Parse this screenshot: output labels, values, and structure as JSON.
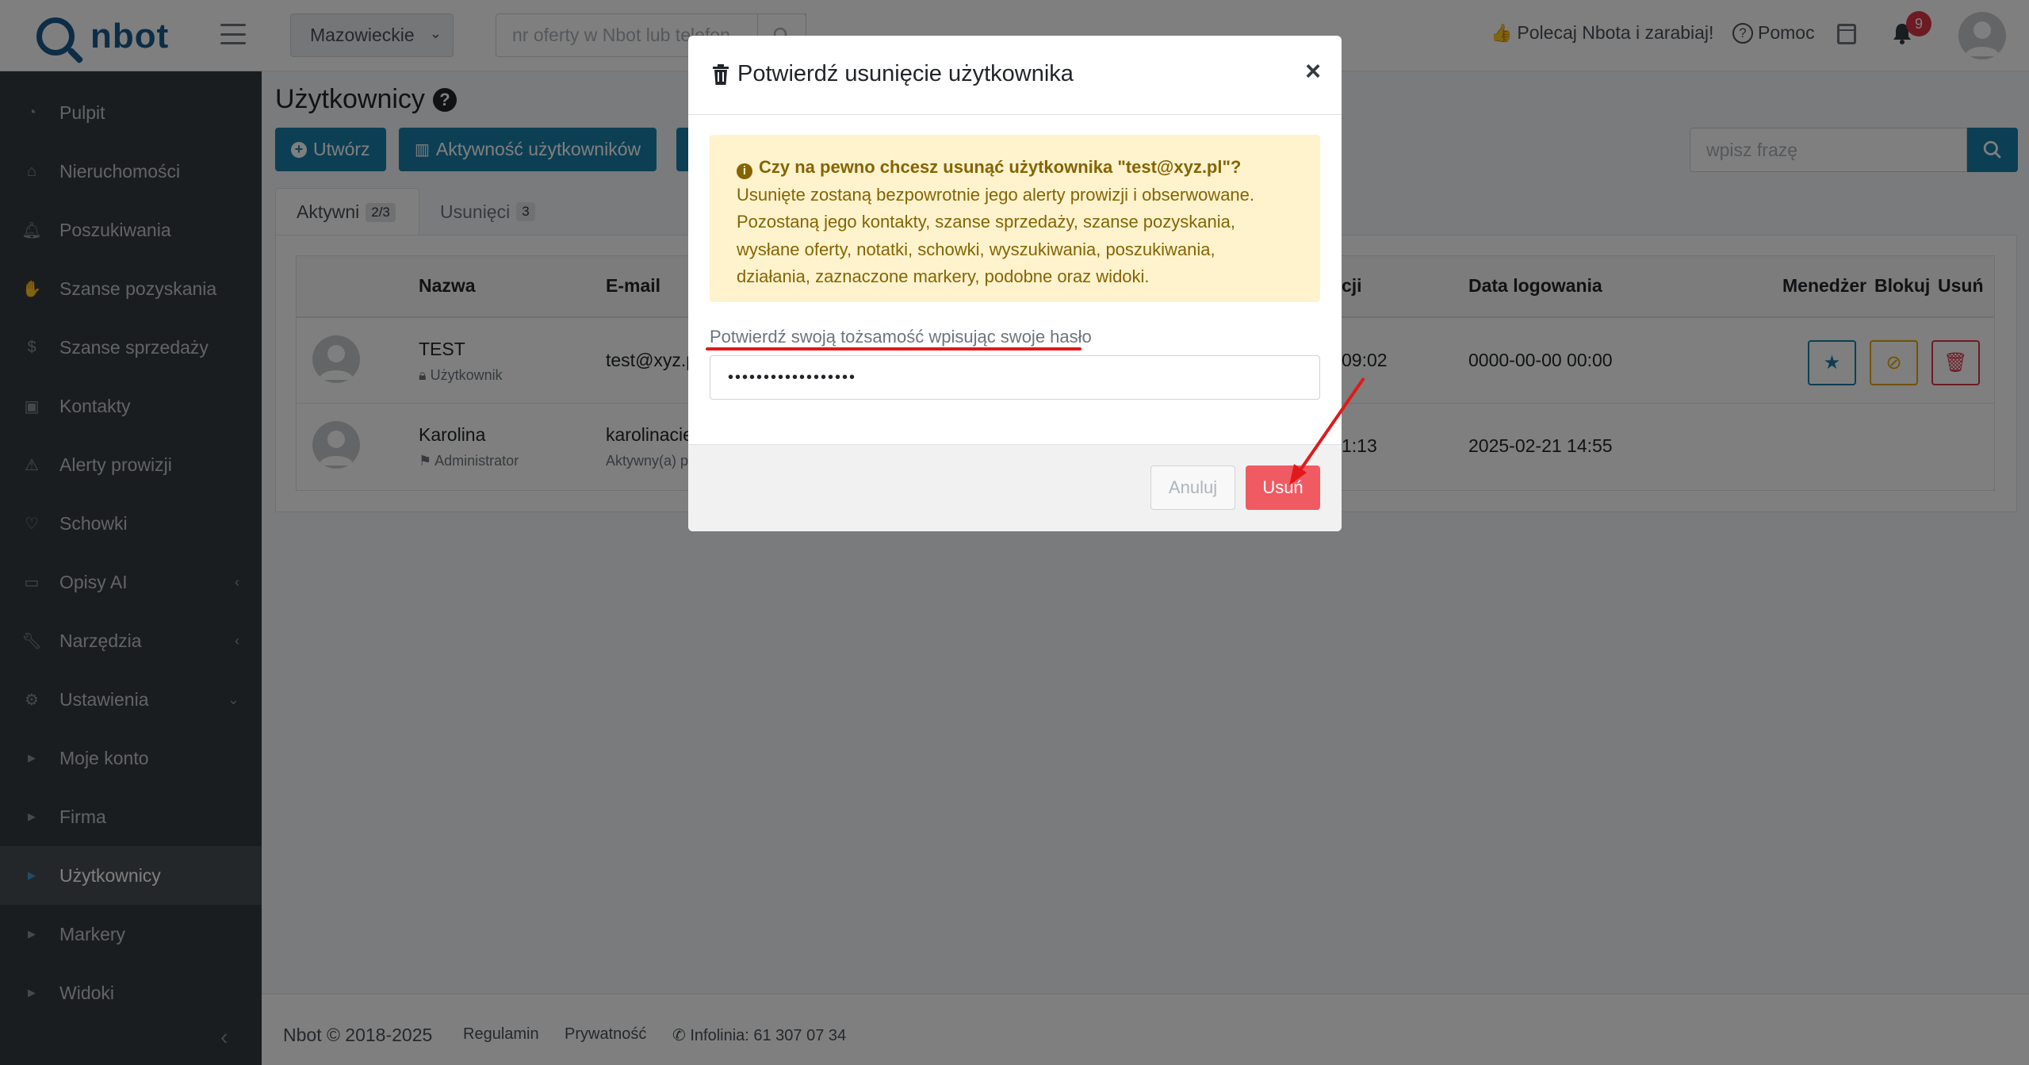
{
  "header": {
    "logo_text": "nbot",
    "region": "Mazowieckie",
    "offer_search_placeholder": "nr oferty w Nbot lub telefon",
    "recommend": "Polecaj Nbota i zarabiaj!",
    "help": "Pomoc",
    "notifications_count": "9"
  },
  "sidebar": {
    "items": [
      {
        "label": "Pulpit",
        "icon": "gauge-icon"
      },
      {
        "label": "Nieruchomości",
        "icon": "house-icon"
      },
      {
        "label": "Poszukiwania",
        "icon": "bell-icon"
      },
      {
        "label": "Szanse pozyskania",
        "icon": "handshake-icon"
      },
      {
        "label": "Szanse sprzedaży",
        "icon": "dollar-icon"
      },
      {
        "label": "Kontakty",
        "icon": "contact-card-icon"
      },
      {
        "label": "Alerty prowizji",
        "icon": "warning-icon"
      },
      {
        "label": "Schowki",
        "icon": "heart-icon"
      },
      {
        "label": "Opisy AI",
        "icon": "comment-icon"
      },
      {
        "label": "Narzędzia",
        "icon": "wrench-icon"
      },
      {
        "label": "Ustawienia",
        "icon": "gear-icon"
      },
      {
        "label": "Moje konto",
        "icon": "caret-right-icon"
      },
      {
        "label": "Firma",
        "icon": "caret-right-icon"
      },
      {
        "label": "Użytkownicy",
        "icon": "caret-right-icon"
      },
      {
        "label": "Markery",
        "icon": "caret-right-icon"
      },
      {
        "label": "Widoki",
        "icon": "caret-right-icon"
      }
    ]
  },
  "main": {
    "title": "Użytkownicy",
    "create_button": "Utwórz",
    "activity_button": "Aktywność użytkowników",
    "search_placeholder": "wpisz frazę",
    "tabs": [
      {
        "label": "Aktywni",
        "badge": "2/3"
      },
      {
        "label": "Usunięci",
        "badge": "3"
      }
    ],
    "table": {
      "columns": {
        "name": "Nazwa",
        "email": "E-mail",
        "created": "cji",
        "last_login": "Data logowania",
        "manager": "Menedżer",
        "block": "Blokuj",
        "delete": "Usuń"
      },
      "rows": [
        {
          "name": "TEST",
          "role": "Użytkownik",
          "email": "test@xyz.p",
          "email_sub": "",
          "created": "09:02",
          "last_login": "0000-00-00 00:00"
        },
        {
          "name": "Karolina",
          "role": "Administrator",
          "email": "karolinacie",
          "email_sub": "Aktywny(a) p",
          "created": "1:13",
          "last_login": "2025-02-21 14:55"
        }
      ]
    }
  },
  "footer": {
    "copyright": "Nbot © 2018-2025",
    "terms": "Regulamin",
    "privacy": "Prywatność",
    "hotline": "Infolinia: 61 307 07 34"
  },
  "modal": {
    "title": "Potwierdź usunięcie użytkownika",
    "question": "Czy na pewno chcesz usunąć użytkownika \"test@xyz.pl\"?",
    "body_lines": [
      "Usunięte zostaną bezpowrotnie jego alerty prowizji i obserwowane.",
      "Pozostaną jego kontakty, szanse sprzedaży, szanse pozyskania,",
      "wysłane oferty, notatki, schowki, wyszukiwania, poszukiwania,",
      "działania, zaznaczone markery, podobne oraz widoki."
    ],
    "password_label": "Potwierdź swoją tożsamość wpisując swoje hasło",
    "password_mask": "••••••••••••••••••",
    "cancel": "Anuluj",
    "confirm": "Usuń"
  },
  "colors": {
    "accent": "#1b7fa8",
    "sidebar_bg": "#343a40",
    "danger": "#dc3545",
    "warning_bg": "#fff3cd",
    "annotation_red": "#e01a1a"
  }
}
